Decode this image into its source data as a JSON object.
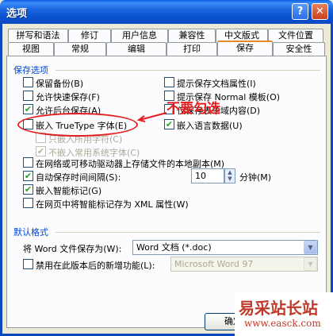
{
  "window": {
    "title": "选项",
    "help_label": "?",
    "close_label": "✕"
  },
  "tabs_row1": [
    "拼写和语法",
    "修订",
    "用户信息",
    "兼容性",
    "中文版式",
    "文件位置"
  ],
  "tabs_row2": [
    "视图",
    "常规",
    "编辑",
    "打印",
    "保存",
    "安全性"
  ],
  "active_tab": "保存",
  "save_options": {
    "section_title": "保存选项",
    "left": [
      {
        "label": "保留备份(B)",
        "checked": false,
        "enabled": true
      },
      {
        "label": "允许快速保存(F)",
        "checked": false,
        "enabled": true
      },
      {
        "label": "允许后台保存(A)",
        "checked": true,
        "enabled": true
      },
      {
        "label": "嵌入 TrueType 字体(E)",
        "checked": false,
        "enabled": true
      },
      {
        "label": "只嵌入所用字符(C)",
        "checked": false,
        "enabled": false
      },
      {
        "label": "不嵌入常用系统字体(C)",
        "checked": true,
        "enabled": false
      }
    ],
    "right": [
      {
        "label": "提示保存文档属性(I)",
        "checked": false,
        "enabled": true
      },
      {
        "label": "提示保存 Normal 模板(O)",
        "checked": false,
        "enabled": true
      },
      {
        "label": "仅保存表单域内容(D)",
        "checked": false,
        "enabled": true
      },
      {
        "label": "嵌入语言数据(U)",
        "checked": true,
        "enabled": true
      }
    ],
    "full": [
      {
        "label": "在网络或可移动驱动器上存储文件的本地副本(M)",
        "checked": false,
        "enabled": true
      },
      {
        "label": "自动保存时间间隔(S):",
        "checked": true,
        "enabled": true
      },
      {
        "label": "嵌入智能标记(G)",
        "checked": true,
        "enabled": true
      },
      {
        "label": "在网页中将智能标记存为 XML 属性(W)",
        "checked": false,
        "enabled": true
      }
    ],
    "autosave_minutes": "10",
    "autosave_unit": "分钟(M)"
  },
  "default_format": {
    "section_title": "默认格式",
    "save_as_label": "将 Word 文件保存为(W):",
    "save_as_value": "Word 文档 (*.doc)",
    "disable_label": "禁用在此版本后的新增功能(L):",
    "disable_checked": false,
    "disable_value": "Microsoft Word 97"
  },
  "annotation": {
    "text": "不要勾选"
  },
  "ok_button": "确定",
  "watermark": {
    "line1": "易采站长站",
    "line2": "www.easck.com"
  },
  "colors": {
    "annotation": "#e41f1f",
    "title_bar": "#0a52d0",
    "section": "#0046d5"
  }
}
